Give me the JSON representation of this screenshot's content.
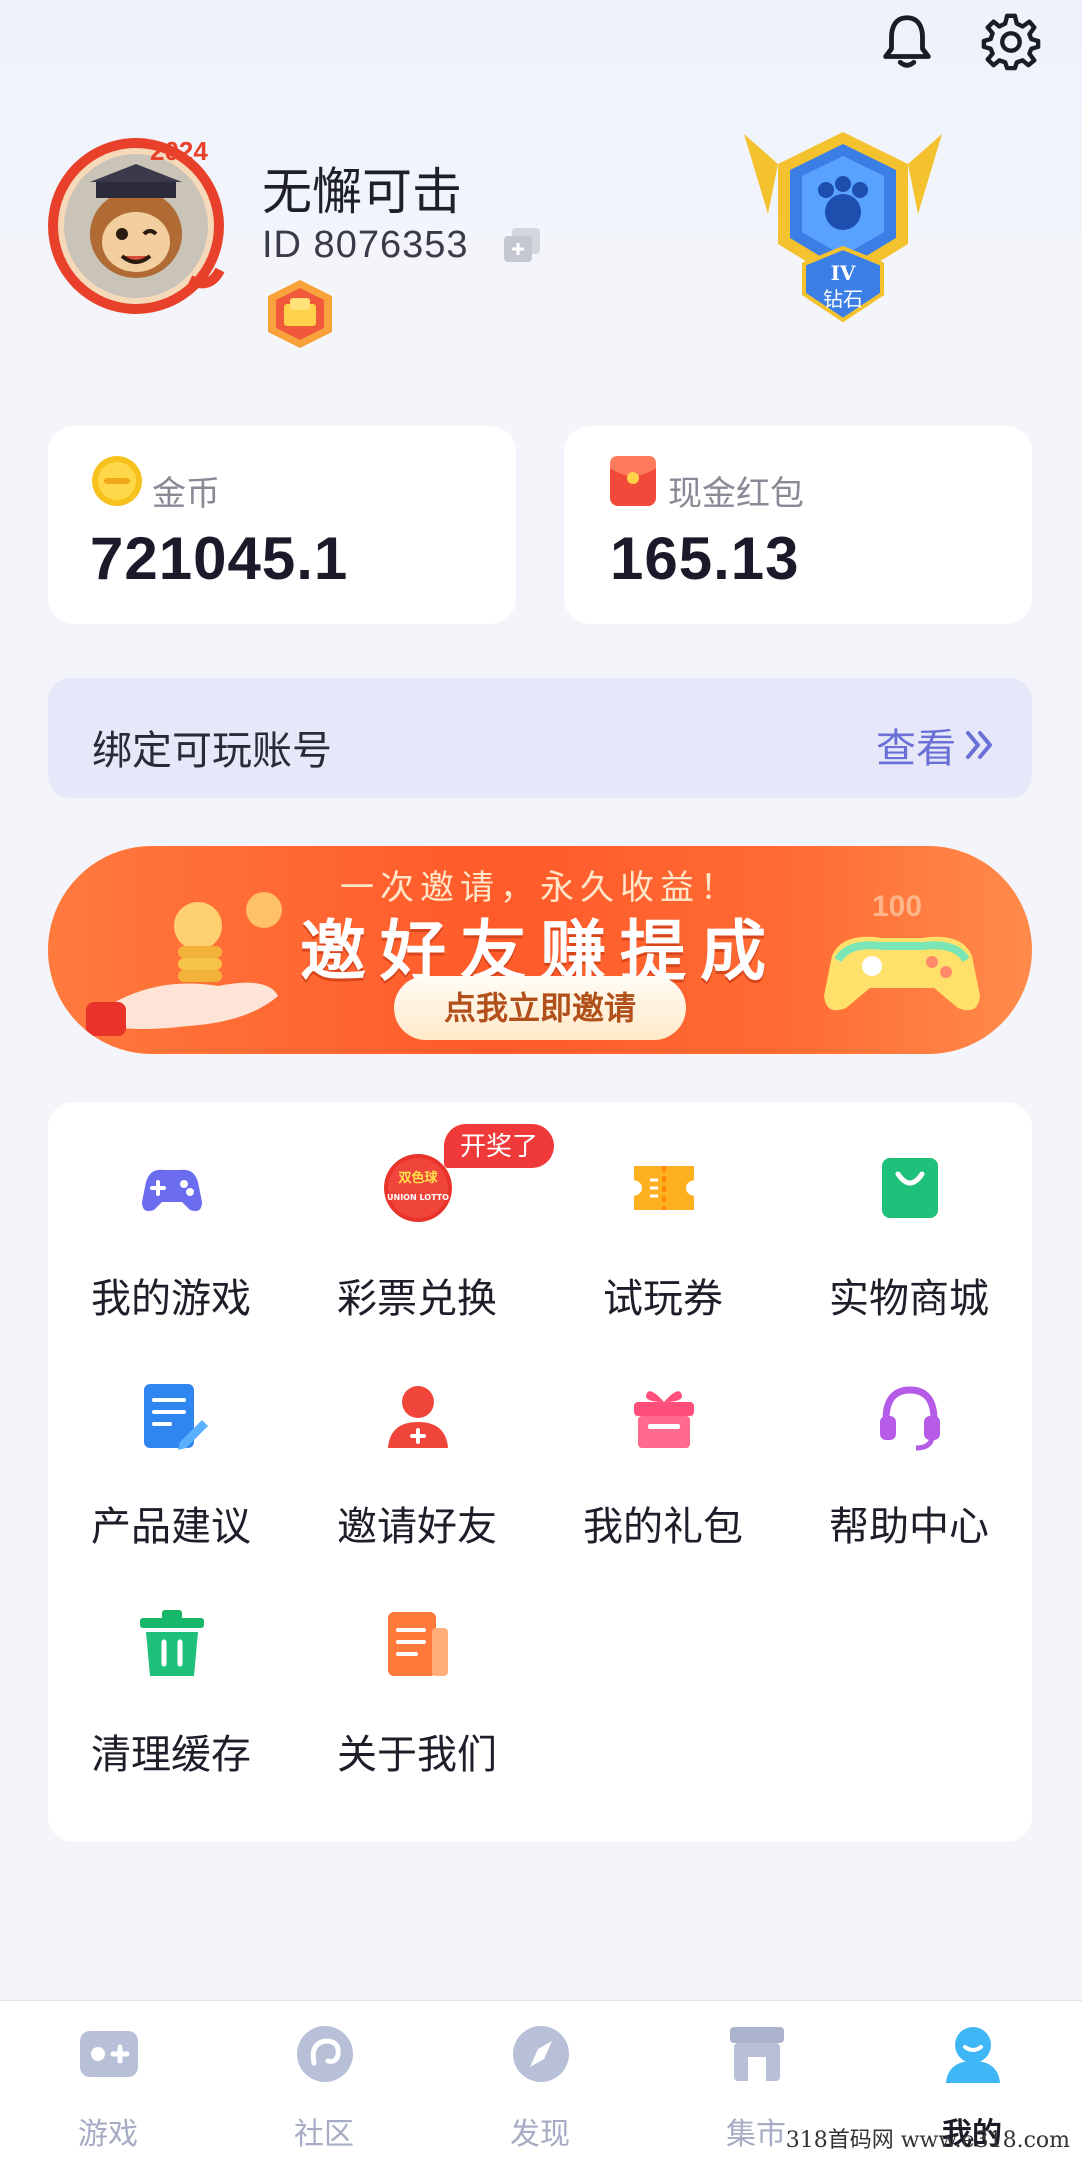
{
  "header": {
    "notification_icon": "bell-icon",
    "settings_icon": "gear-icon"
  },
  "profile": {
    "username": "无懈可击",
    "id_text": "ID 8076353",
    "avatar_badge_text": "2024",
    "rank_text": "钻石",
    "rank_level": "IV"
  },
  "wallet": {
    "coin_label": "金币",
    "coin_value": "721045.1",
    "cash_label": "现金红包",
    "cash_value": "165.13"
  },
  "bind": {
    "label": "绑定可玩账号",
    "view_label": "查看"
  },
  "banner": {
    "subtitle": "一次邀请，永久收益！",
    "title": "邀好友赚提成",
    "button": "点我立即邀请",
    "corner_text": "100"
  },
  "menu": {
    "prize_tag": "开奖了",
    "lottery_icon_text_1": "双色球",
    "lottery_icon_text_2": "UNION LOTTO",
    "items": [
      {
        "label": "我的游戏",
        "icon": "gamepad-icon"
      },
      {
        "label": "彩票兑换",
        "icon": "lottery-ball-icon"
      },
      {
        "label": "试玩券",
        "icon": "ticket-icon"
      },
      {
        "label": "实物商城",
        "icon": "shopping-bag-icon"
      },
      {
        "label": "产品建议",
        "icon": "document-edit-icon"
      },
      {
        "label": "邀请好友",
        "icon": "add-user-icon"
      },
      {
        "label": "我的礼包",
        "icon": "gift-icon"
      },
      {
        "label": "帮助中心",
        "icon": "headset-icon"
      },
      {
        "label": "清理缓存",
        "icon": "trash-icon"
      },
      {
        "label": "关于我们",
        "icon": "info-document-icon"
      }
    ]
  },
  "tabbar": {
    "items": [
      {
        "label": "游戏",
        "icon": "game-tab-icon"
      },
      {
        "label": "社区",
        "icon": "community-tab-icon"
      },
      {
        "label": "发现",
        "icon": "compass-tab-icon"
      },
      {
        "label": "集市",
        "icon": "market-tab-icon"
      },
      {
        "label": "我的",
        "icon": "profile-tab-icon"
      }
    ],
    "active": "我的"
  },
  "watermark": "318首码网  www.e318.com",
  "colors": {
    "accent": "#6a70d6",
    "banner": "#ff5a2a",
    "active_tab": "#3fb6f5"
  }
}
